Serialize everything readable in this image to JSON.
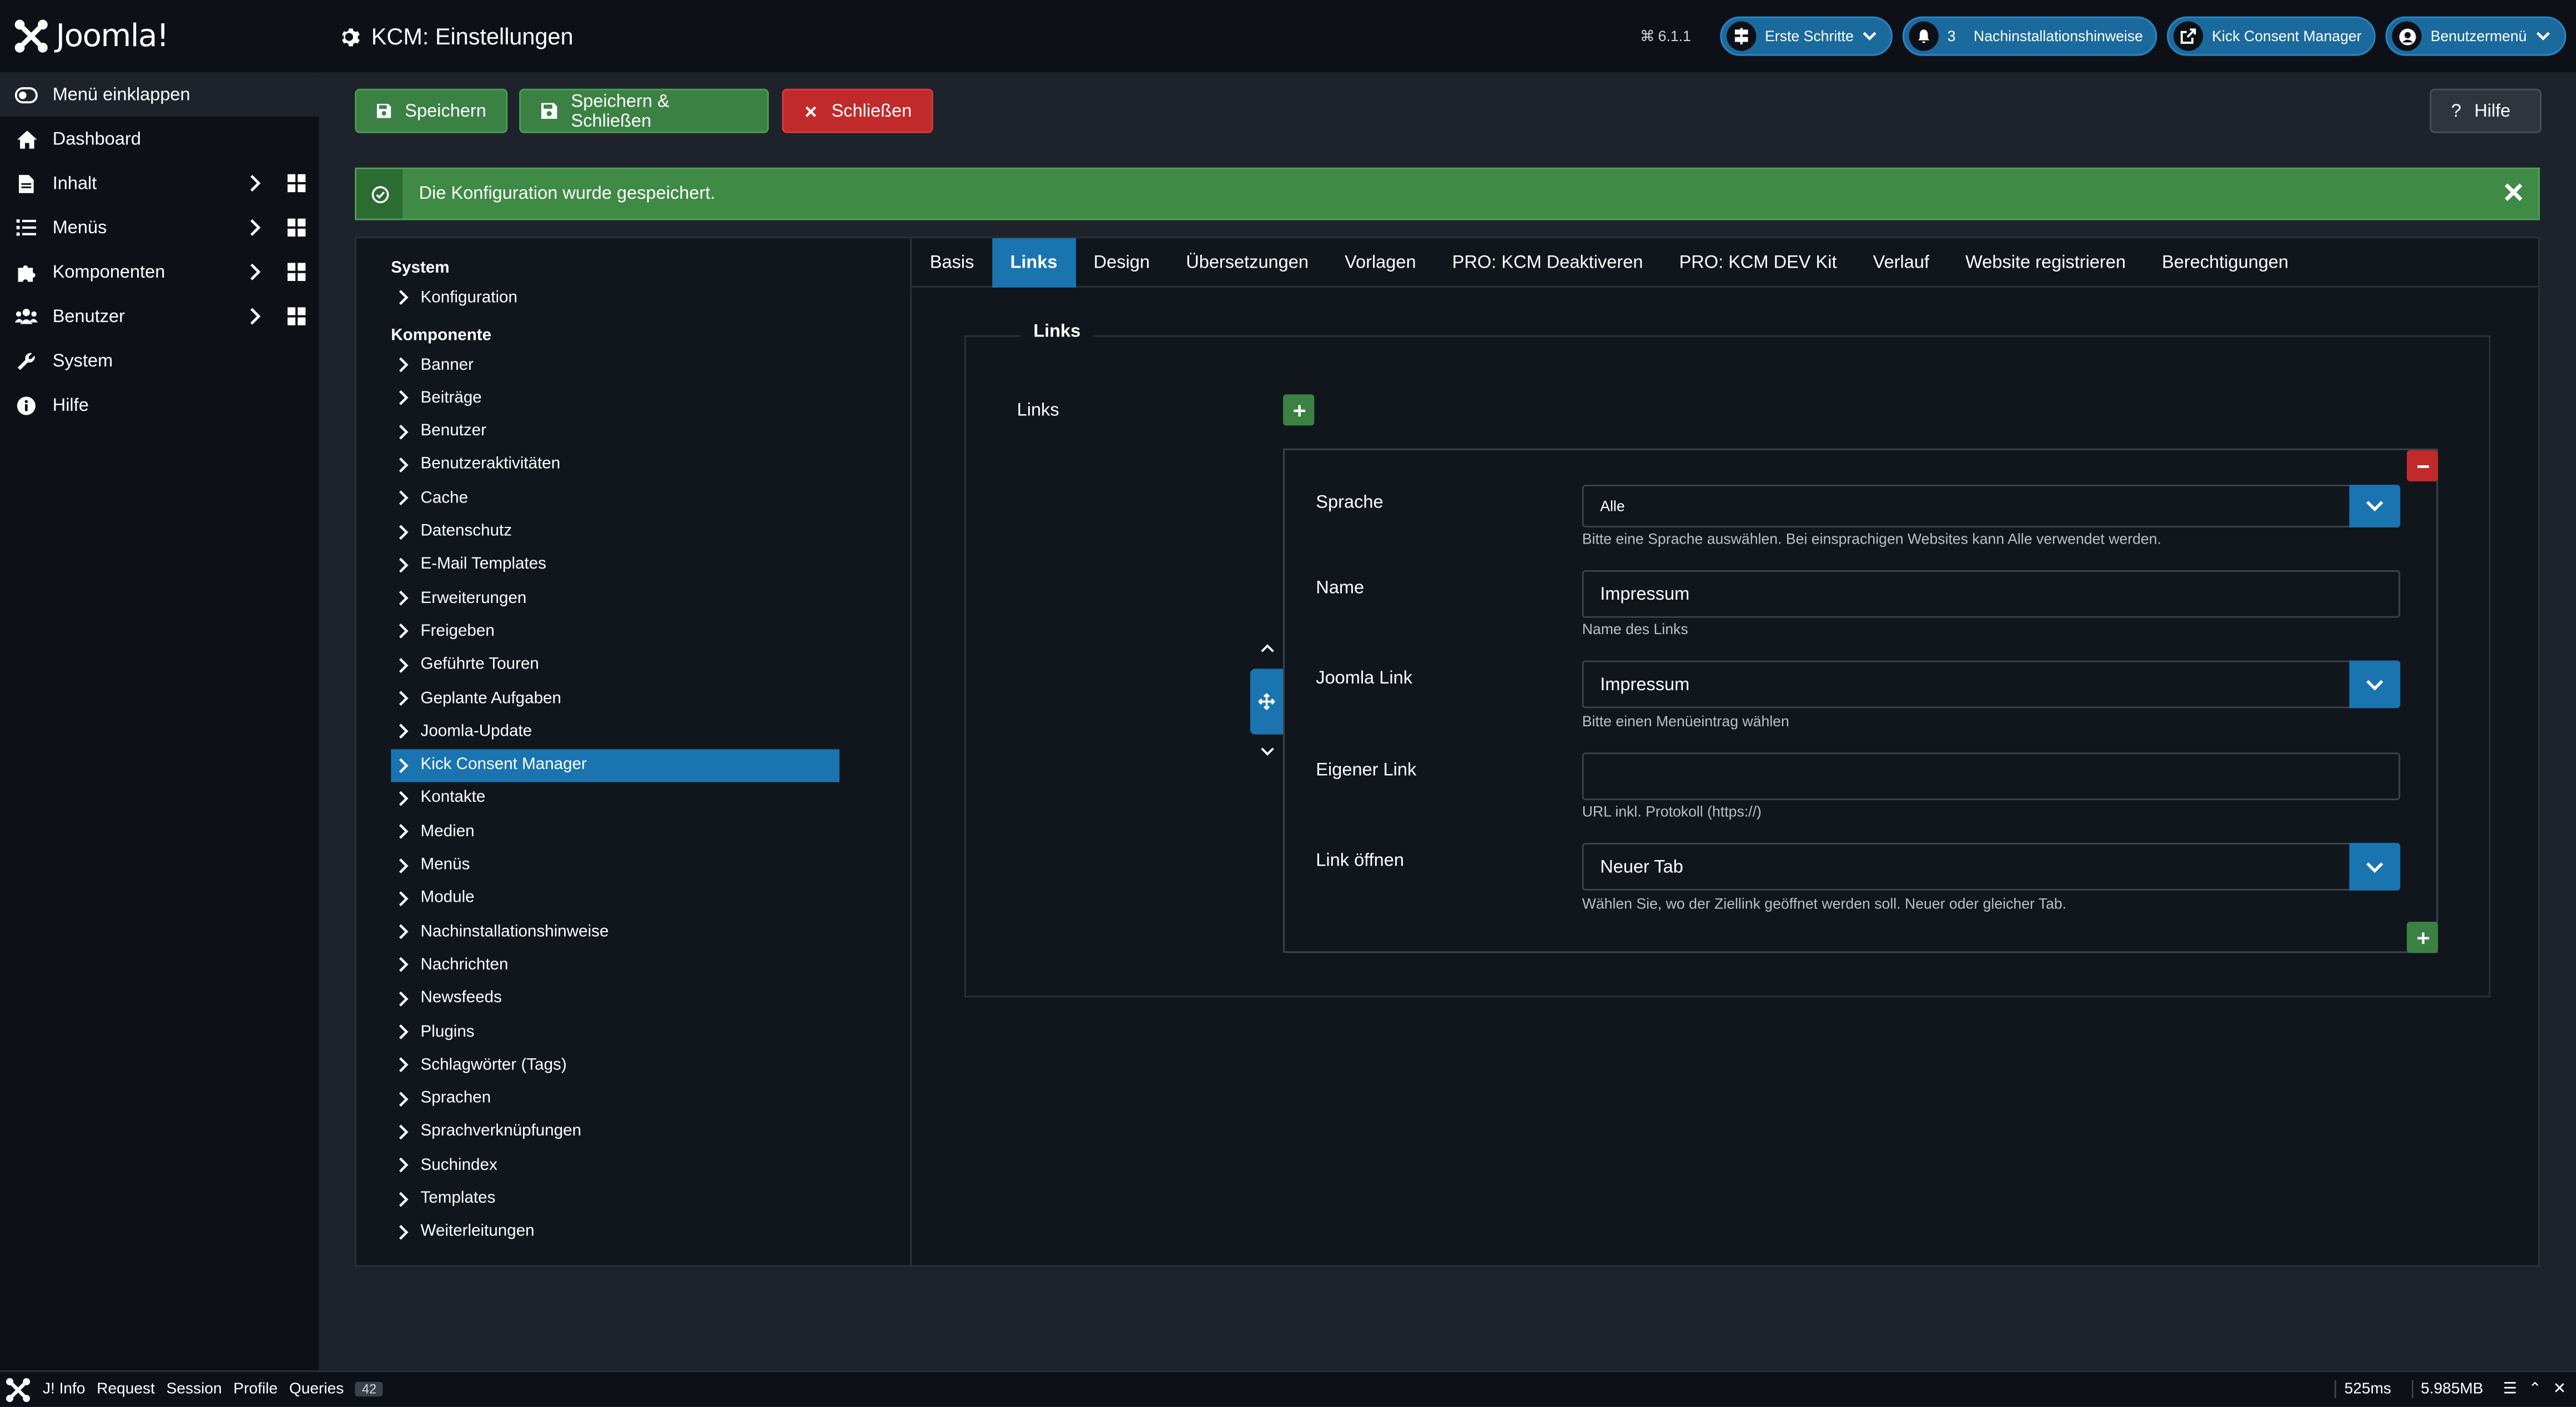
{
  "header": {
    "logo_text": "Joomla!",
    "title": "KCM: Einstellungen",
    "version": "6.1.1",
    "pills": {
      "first_steps": "Erste Schritte",
      "notifications_count": "3",
      "post_install": "Nachinstallationshinweise",
      "kcm": "Kick Consent Manager",
      "user_menu": "Benutzermenü"
    }
  },
  "sidebar": {
    "toggle": "Menü einklappen",
    "items": [
      {
        "label": "Dashboard"
      },
      {
        "label": "Inhalt"
      },
      {
        "label": "Menüs"
      },
      {
        "label": "Komponenten"
      },
      {
        "label": "Benutzer"
      },
      {
        "label": "System"
      },
      {
        "label": "Hilfe"
      }
    ]
  },
  "toolbar": {
    "save": "Speichern",
    "save_close": "Speichern & Schließen",
    "close": "Schließen",
    "help": "Hilfe"
  },
  "alert": {
    "message": "Die Konfiguration wurde gespeichert."
  },
  "tree": {
    "system_heading": "System",
    "system_items": [
      "Konfiguration"
    ],
    "component_heading": "Komponente",
    "component_items": [
      "Banner",
      "Beiträge",
      "Benutzer",
      "Benutzeraktivitäten",
      "Cache",
      "Datenschutz",
      "E-Mail Templates",
      "Erweiterungen",
      "Freigeben",
      "Geführte Touren",
      "Geplante Aufgaben",
      "Joomla-Update",
      "Kick Consent Manager",
      "Kontakte",
      "Medien",
      "Menüs",
      "Module",
      "Nachinstallationshinweise",
      "Nachrichten",
      "Newsfeeds",
      "Plugins",
      "Schlagwörter (Tags)",
      "Sprachen",
      "Sprachverknüpfungen",
      "Suchindex",
      "Templates",
      "Weiterleitungen"
    ],
    "selected": "Kick Consent Manager"
  },
  "tabs": [
    "Basis",
    "Links",
    "Design",
    "Übersetzungen",
    "Vorlagen",
    "PRO: KCM Deaktiveren",
    "PRO: KCM DEV Kit",
    "Verlauf",
    "Website registrieren",
    "Berechtigungen"
  ],
  "active_tab": "Links",
  "form": {
    "legend": "Links",
    "links_label": "Links",
    "fields": {
      "sprache": {
        "label": "Sprache",
        "value": "Alle",
        "help": "Bitte eine Sprache auswählen. Bei einsprachigen Websites kann Alle verwendet werden."
      },
      "name": {
        "label": "Name",
        "value": "Impressum",
        "help": "Name des Links"
      },
      "joomla_link": {
        "label": "Joomla Link",
        "value": "Impressum",
        "help": "Bitte einen Menüeintrag wählen"
      },
      "eigener_link": {
        "label": "Eigener Link",
        "value": "",
        "help": "URL inkl. Protokoll (https://)"
      },
      "link_oeffnen": {
        "label": "Link öffnen",
        "value": "Neuer Tab",
        "help": "Wählen Sie, wo der Ziellink geöffnet werden soll. Neuer oder gleicher Tab."
      }
    }
  },
  "footer": {
    "items": [
      "J! Info",
      "Request",
      "Session",
      "Profile",
      "Queries"
    ],
    "queries_count": "42",
    "time": "525ms",
    "memory": "5.985MB"
  },
  "colors": {
    "accent": "#1a74b0",
    "success": "#3b8144",
    "danger": "#c12a2a",
    "background": "#1e232b",
    "sidebar": "#0d1117"
  }
}
